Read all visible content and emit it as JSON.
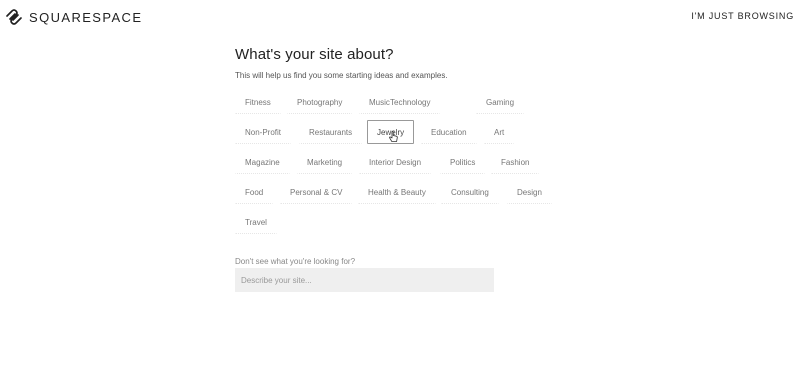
{
  "header": {
    "brand": "SQUARESPACE",
    "browse_link": "I'M JUST BROWSING"
  },
  "main": {
    "title": "What's your site about?",
    "subtitle": "This will help us find you some starting ideas and examples.",
    "categories": [
      {
        "label": "Fitness"
      },
      {
        "label": "Photography"
      },
      {
        "label": "Music"
      },
      {
        "label": "Technology"
      },
      {
        "label": "Gaming"
      },
      {
        "label": "Non-Profit"
      },
      {
        "label": "Restaurants"
      },
      {
        "label": "Jewelry",
        "selected": true
      },
      {
        "label": "Education"
      },
      {
        "label": "Art"
      },
      {
        "label": "Magazine"
      },
      {
        "label": "Marketing"
      },
      {
        "label": "Interior Design"
      },
      {
        "label": "Politics"
      },
      {
        "label": "Fashion"
      },
      {
        "label": "Food"
      },
      {
        "label": "Personal & CV"
      },
      {
        "label": "Health & Beauty"
      },
      {
        "label": "Consulting"
      },
      {
        "label": "Design"
      },
      {
        "label": "Travel"
      }
    ],
    "other_label": "Don't see what you're looking for?",
    "other_input": {
      "placeholder": "Describe your site...",
      "value": ""
    }
  },
  "colors": {
    "background": "#ffffff",
    "text": "#222222",
    "muted": "#777777",
    "input_bg": "#efefef",
    "selected_border": "#999999"
  },
  "icons": [
    "squarespace-logo-icon",
    "pointer-cursor-icon"
  ]
}
